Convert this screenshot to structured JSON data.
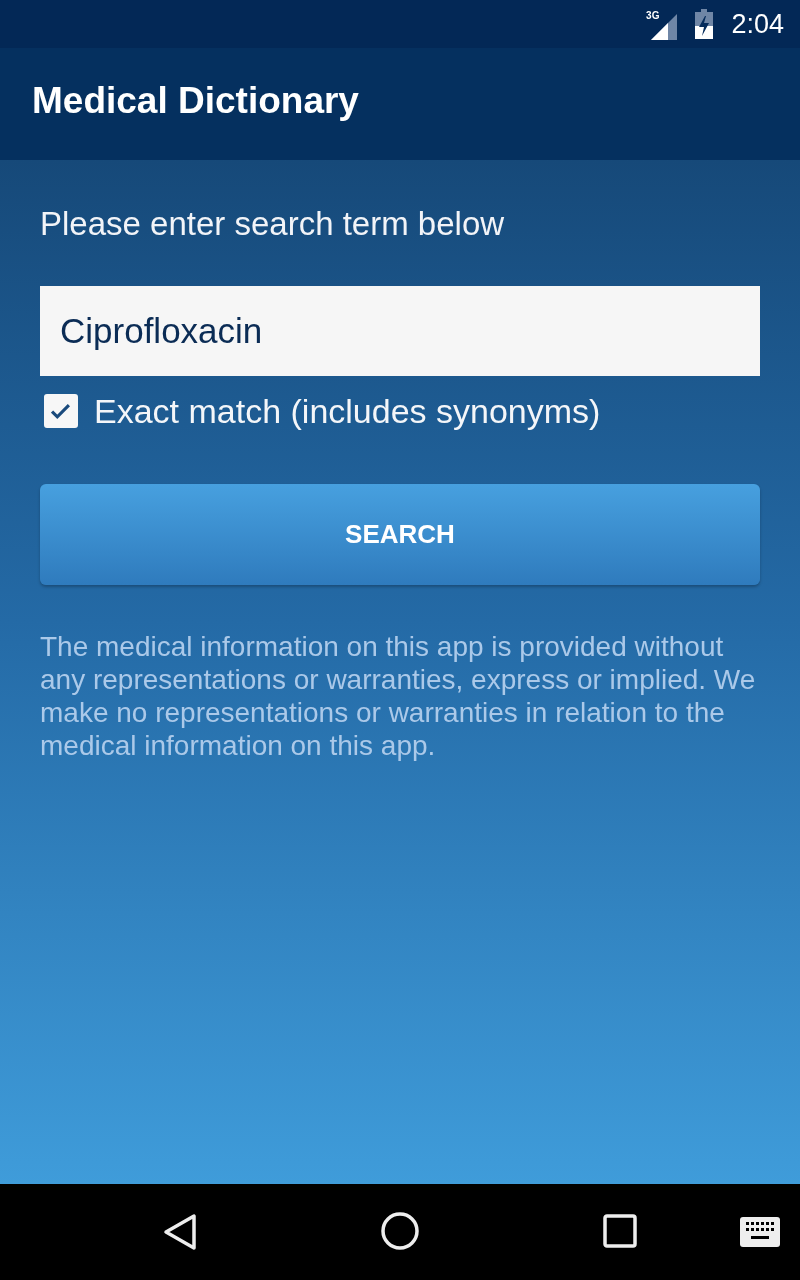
{
  "status_bar": {
    "network": "3G",
    "time": "2:04"
  },
  "app_bar": {
    "title": "Medical Dictionary"
  },
  "search_form": {
    "prompt": "Please enter search term below",
    "search_field": {
      "value": "Ciprofloxacin"
    },
    "exact_match": {
      "label": "Exact match (includes synonyms)",
      "checked": true
    },
    "search_button": {
      "label": "SEARCH"
    }
  },
  "disclaimer": "The medical information on this app is provided without any representations or warranties, express or implied. We make no representations or warranties in relation to the medical information on this app."
}
